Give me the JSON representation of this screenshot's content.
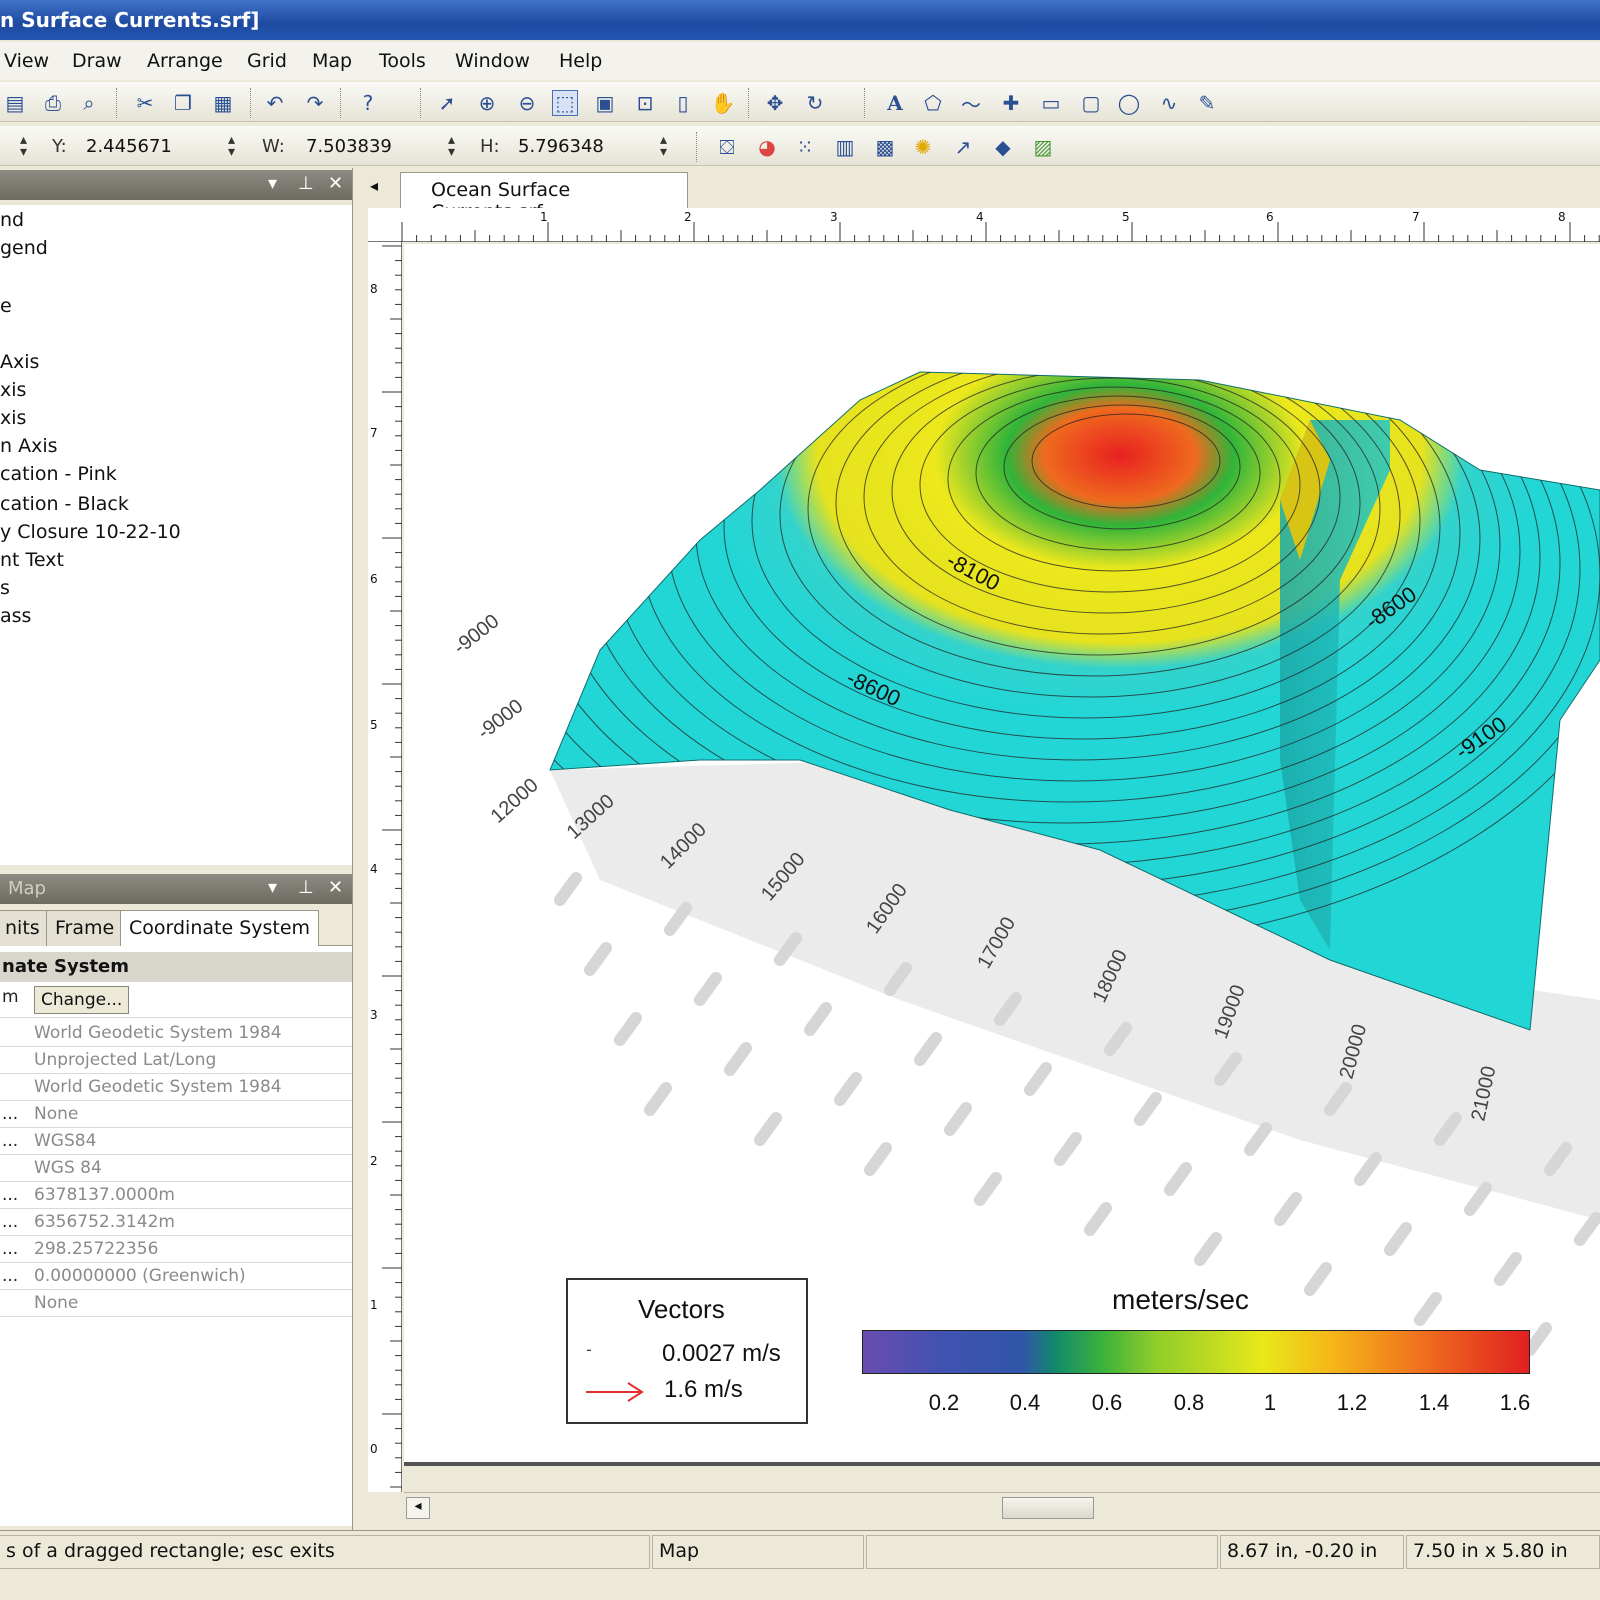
{
  "window": {
    "title": "n Surface Currents.srf]"
  },
  "menu": [
    "View",
    "Draw",
    "Arrange",
    "Grid",
    "Map",
    "Tools",
    "Window",
    "Help"
  ],
  "toolbar1_icons": [
    "save-all-icon",
    "print-icon",
    "print-preview-icon",
    "cut-icon",
    "copy-icon",
    "paste-icon",
    "undo-icon",
    "redo-icon",
    "help-pointer-icon",
    "select-icon",
    "zoom-in-icon",
    "zoom-out-icon",
    "zoom-rect-icon",
    "zoom-selected-icon",
    "zoom-fit-icon",
    "zoom-page-icon",
    "pan-icon",
    "move-icon",
    "rotate-icon",
    "text-icon",
    "polygon-icon",
    "polyline-icon",
    "symbol-icon",
    "rectangle-icon",
    "rounded-rect-icon",
    "ellipse-icon",
    "spline-icon",
    "reshape-icon"
  ],
  "toolbar2": {
    "y_label": "Y:",
    "y_value": "2.445671",
    "w_label": "W:",
    "w_value": "7.503839",
    "h_label": "H:",
    "h_value": "5.796348"
  },
  "toolbar2_icons": [
    "base-map-icon",
    "contour-map-icon",
    "post-map-icon",
    "image-map-icon",
    "shaded-relief-icon",
    "lighting-icon",
    "vector-map-icon",
    "3d-surface-icon",
    "color-scale-icon"
  ],
  "object_manager": {
    "items": [
      "nd",
      "gend",
      "e",
      "Axis",
      "xis",
      "xis",
      "n Axis",
      "cation - Pink",
      "cation - Black",
      "y Closure 10-22-10",
      "nt Text",
      "s",
      "ass"
    ]
  },
  "property_panel": {
    "title": "Map",
    "tabs": [
      "nits",
      "Frame",
      "Coordinate System"
    ],
    "section": "nate System",
    "change_label": "Change...",
    "rows": [
      {
        "k": "m",
        "v": ""
      },
      {
        "k": "",
        "v": "World Geodetic System 1984"
      },
      {
        "k": "",
        "v": "Unprojected Lat/Long"
      },
      {
        "k": "",
        "v": "World Geodetic System 1984"
      },
      {
        "k": "...",
        "v": "None"
      },
      {
        "k": "...",
        "v": "WGS84"
      },
      {
        "k": "",
        "v": "WGS 84"
      },
      {
        "k": "...",
        "v": "6378137.0000m"
      },
      {
        "k": "...",
        "v": "6356752.3142m"
      },
      {
        "k": "...",
        "v": "298.25722356"
      },
      {
        "k": "...",
        "v": "0.00000000 (Greenwich)"
      },
      {
        "k": "",
        "v": "None"
      }
    ]
  },
  "document": {
    "tab": "Ocean Surface Currents.srf"
  },
  "ruler_top": [
    "1",
    "2",
    "3",
    "4",
    "5",
    "6",
    "7",
    "8"
  ],
  "ruler_left": [
    "8",
    "7",
    "6",
    "5",
    "4",
    "3",
    "2",
    "1",
    "0"
  ],
  "map": {
    "contour_labels": [
      "-8100",
      "-8600",
      "-8600",
      "-9100"
    ],
    "axis_labels": [
      "-9000",
      "-9000",
      "12000",
      "13000",
      "14000",
      "15000",
      "16000",
      "17000",
      "18000",
      "19000",
      "20000",
      "21000"
    ]
  },
  "vectors_legend": {
    "title": "Vectors",
    "small_value": "0.0027 m/s",
    "large_value": "1.6 m/s"
  },
  "color_scale": {
    "title": "meters/sec",
    "ticks": [
      "0.2",
      "0.4",
      "0.6",
      "0.8",
      "1",
      "1.2",
      "1.4",
      "1.6"
    ]
  },
  "status": {
    "hint": "s of a dragged rectangle; esc exits",
    "mode": "Map",
    "cursor": "8.67 in, -0.20 in",
    "size": "7.50 in x 5.80 in"
  }
}
